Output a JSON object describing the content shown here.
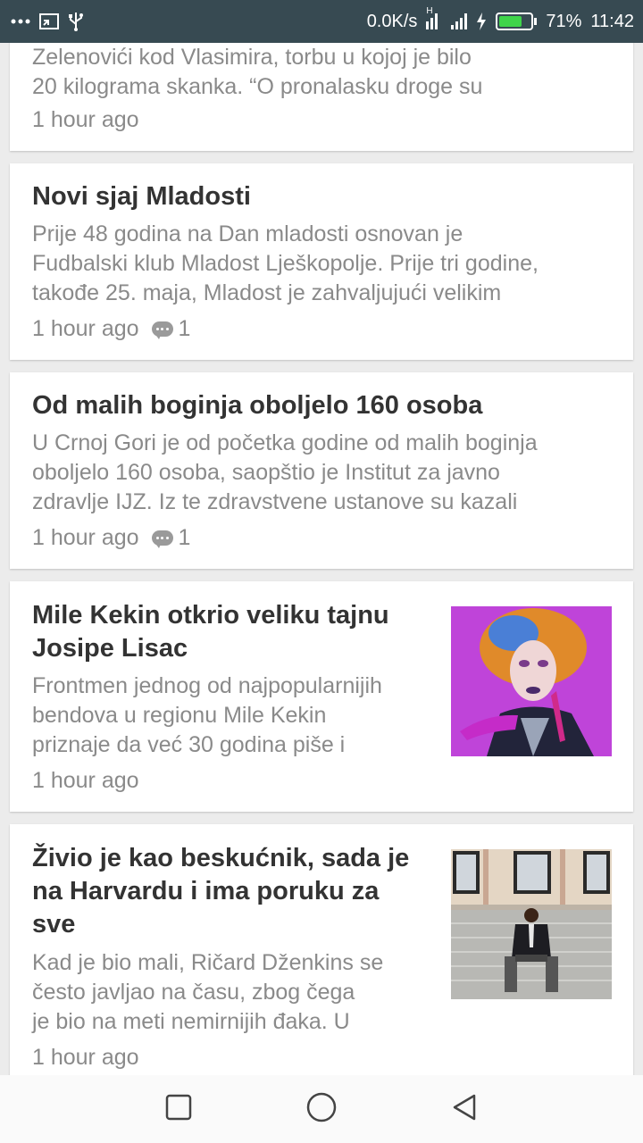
{
  "status_bar": {
    "left_icons": [
      "more-icon",
      "screen-cast-icon",
      "usb-icon"
    ],
    "net_speed": "0.0K/s",
    "signal_label": "H",
    "battery_percent": "71%",
    "battery_level": 0.71,
    "time": "11:42",
    "colors": {
      "background": "#374a52",
      "battery_fill": "#3fd44a"
    }
  },
  "articles": [
    {
      "title": "",
      "excerpt_lines": [
        "Zelenovići kod Vlasimira, torbu u kojoj je bilo",
        "20 kilograma skanka. “O pronalasku droge su"
      ],
      "time": "1 hour ago",
      "comments": null
    },
    {
      "title": "Novi sjaj Mladosti",
      "excerpt_lines": [
        "Prije 48 godina na Dan mladosti osnovan je",
        "Fudbalski klub Mladost Lješkopolje. Prije tri godine,",
        "takođe 25. maja, Mladost je zahvaljujući velikim"
      ],
      "time": "1 hour ago",
      "comments": "1"
    },
    {
      "title": "Od malih boginja oboljelo 160 osoba",
      "excerpt_lines": [
        "U Crnoj Gori je od početka godine od malih boginja",
        "oboljelo 160 osoba, saopštio je Institut za javno",
        "zdravlje IJZ. Iz te zdravstvene ustanove su kazali"
      ],
      "time": "1 hour ago",
      "comments": "1"
    },
    {
      "title_lines": [
        "Mile Kekin otkrio veliku tajnu",
        "Josipe Lisac"
      ],
      "excerpt_lines": [
        "Frontmen jednog od najpopularnijih",
        "bendova u regionu Mile Kekin",
        "priznaje da već 30 godina piše i"
      ],
      "time": "1 hour ago",
      "comments": null,
      "thumbnail": "woman-orange-hair-photo"
    },
    {
      "title_lines": [
        "Živio je kao beskućnik, sada je",
        "na Harvardu i ima poruku za",
        "sve"
      ],
      "excerpt_lines": [
        "Kad je bio mali, Ričard Dženkins se",
        "često javljao na času, zbog čega",
        "je bio na meti nemirnijih đaka. U"
      ],
      "time": "1 hour ago",
      "comments": null,
      "thumbnail": "man-on-steps-photo"
    }
  ],
  "nav_bar": {
    "buttons": [
      "recent-apps-icon",
      "home-icon",
      "back-icon"
    ]
  }
}
